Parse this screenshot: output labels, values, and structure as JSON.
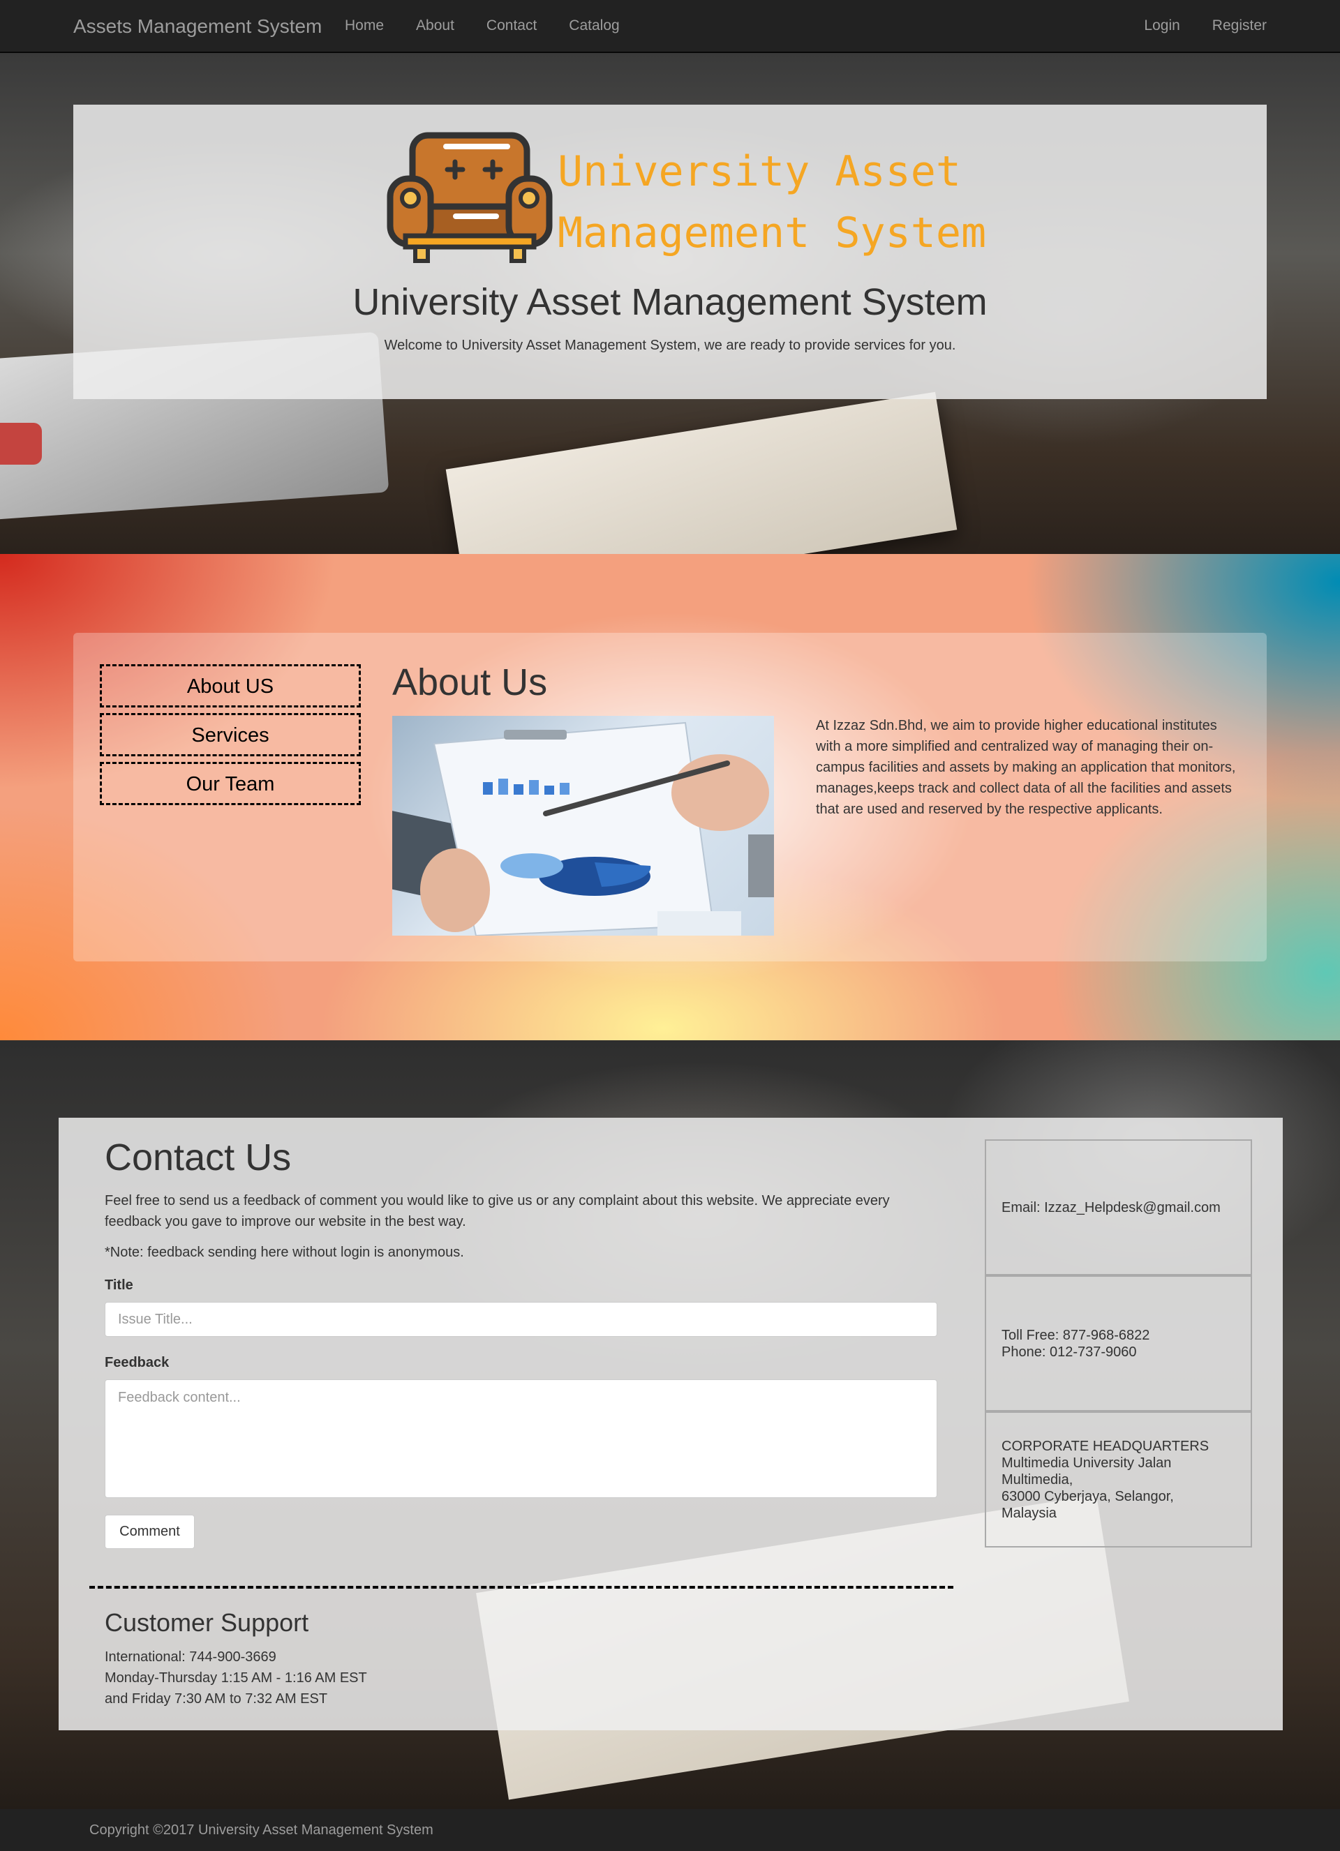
{
  "navbar": {
    "brand": "Assets Management System",
    "left_links": [
      "Home",
      "About",
      "Contact",
      "Catalog"
    ],
    "right_links": [
      "Login",
      "Register"
    ]
  },
  "hero": {
    "logo_line1": "University Asset",
    "logo_line2": "Management System",
    "title": "University Asset Management System",
    "subtitle": "Welcome to University Asset Management System, we are ready to provide services for you."
  },
  "about": {
    "sidebar": [
      "About US",
      "Services",
      "Our Team"
    ],
    "heading": "About Us",
    "text": "At Izzaz Sdn.Bhd, we aim to provide higher educational institutes with a more simplified and centralized way of managing their on-campus facilities and assets by making an application that monitors, manages,keeps track and collect data of all the facilities and assets that are used and reserved by the respective applicants."
  },
  "contact": {
    "title": "Contact Us",
    "description": "Feel free to send us a feedback of comment you would like to give us or any complaint about this website. We appreciate every feedback you gave to improve our website in the best way.",
    "note": "*Note: feedback sending here without login is anonymous.",
    "title_label": "Title",
    "title_placeholder": "Issue Title...",
    "feedback_label": "Feedback",
    "feedback_placeholder": "Feedback content...",
    "comment_button": "Comment",
    "email": "Email: Izzaz_Helpdesk@gmail.com",
    "toll_free": "Toll Free: 877-968-6822",
    "phone": "Phone: 012-737-9060",
    "hq_lines": [
      "CORPORATE HEADQUARTERS",
      "Multimedia University Jalan",
      "Multimedia,",
      "63000 Cyberjaya, Selangor,",
      "Malaysia"
    ],
    "support_title": "Customer Support",
    "support_lines": [
      "International: 744-900-3669",
      "Monday-Thursday 1:15 AM - 1:16 AM EST",
      "and Friday 7:30 AM to 7:32 AM EST"
    ]
  },
  "footer": {
    "copyright": "Copyright ©2017 University Asset Management System"
  },
  "colors": {
    "navbar_bg": "#222222",
    "nav_text": "#9d9d9d",
    "logo_orange": "#f5a623",
    "armchair": "#c8762c"
  },
  "icons": {
    "logo": "armchair-icon"
  }
}
